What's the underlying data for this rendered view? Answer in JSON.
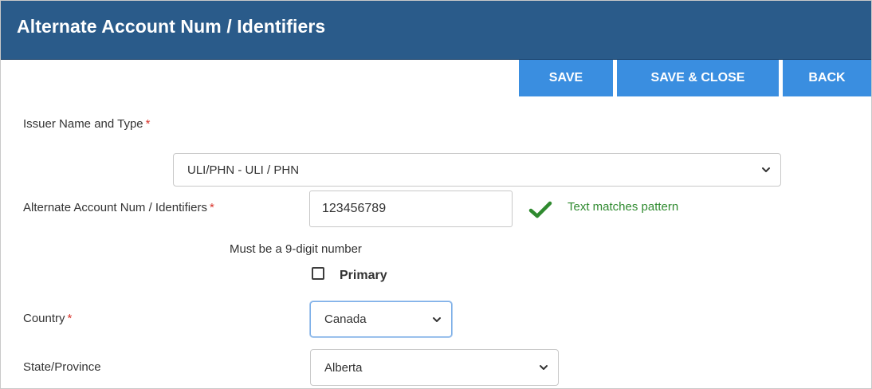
{
  "header": {
    "title": "Alternate Account Num / Identifiers"
  },
  "toolbar": {
    "save_label": "SAVE",
    "save_close_label": "SAVE & CLOSE",
    "back_label": "BACK"
  },
  "form": {
    "issuer": {
      "label": "Issuer Name and Type",
      "required_mark": "*",
      "value": "ULI/PHN - ULI / PHN"
    },
    "identifier": {
      "label": "Alternate Account Num / Identifiers",
      "required_mark": "*",
      "value": "123456789",
      "validation_message": "Text matches pattern",
      "hint": "Must be a 9-digit number"
    },
    "primary": {
      "label": "Primary",
      "checked": false
    },
    "country": {
      "label": "Country",
      "required_mark": "*",
      "value": "Canada"
    },
    "state": {
      "label": "State/Province",
      "value": "Alberta"
    }
  },
  "colors": {
    "header_bg": "#2a5b8a",
    "button_bg": "#3a8ee0",
    "required": "#d9342b",
    "valid": "#2f8a2f"
  }
}
